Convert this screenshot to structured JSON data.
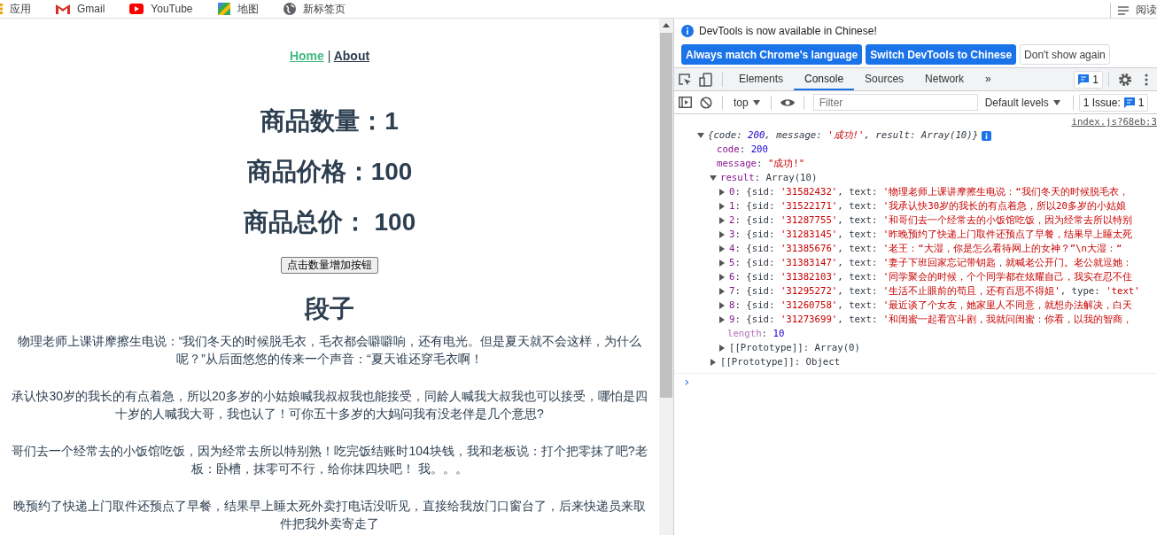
{
  "bookmarks": [
    {
      "label": "应用",
      "kind": "apps"
    },
    {
      "label": "Gmail",
      "kind": "gmail"
    },
    {
      "label": "YouTube",
      "kind": "youtube"
    },
    {
      "label": "地图",
      "kind": "maps"
    },
    {
      "label": "新标签页",
      "kind": "globe"
    }
  ],
  "reading_list": {
    "label": "阅读"
  },
  "page": {
    "nav": [
      {
        "label": "Home",
        "active": true
      },
      {
        "label": "About",
        "active": false
      }
    ],
    "nav_separator": "|",
    "stats": [
      "商品数量：1",
      "商品价格：100",
      "商品总价： 100"
    ],
    "button": "点击数量增加按钮",
    "heading": "段子",
    "jokes": [
      "物理老师上课讲摩擦生电说：“我们冬天的时候脱毛衣，毛衣都会噼噼响，还有电光。但是夏天就不会这样，为什么呢？”从后面悠悠的传来一个声音：“夏天谁还穿毛衣啊！",
      "承认快30岁的我长的有点着急，所以20多岁的小姑娘喊我叔叔我也能接受，同龄人喊我大叔我也可以接受，哪怕是四十岁的人喊我大哥，我也认了！可你五十多岁的大妈问我有没老伴是几个意思?",
      "哥们去一个经常去的小饭馆吃饭，因为经常去所以特别熟！吃完饭结账时104块钱，我和老板说：打个把零抹了吧?老板：卧槽，抹零可不行，给你抹四块吧！ 我。。。",
      "晚预约了快递上门取件还预点了早餐，结果早上睡太死外卖打电话没听见，直接给我放门口窗台了，后来快递员来取件把我外卖寄走了"
    ]
  },
  "devtools": {
    "notice": "DevTools is now available in Chinese!",
    "notice_buttons": [
      {
        "label": "Always match Chrome's language",
        "primary": true
      },
      {
        "label": "Switch DevTools to Chinese",
        "primary": true
      },
      {
        "label": "Don't show again",
        "primary": false
      }
    ],
    "tabs": [
      {
        "label": "Elements",
        "selected": false
      },
      {
        "label": "Console",
        "selected": true
      },
      {
        "label": "Sources",
        "selected": false
      },
      {
        "label": "Network",
        "selected": false
      }
    ],
    "more_tabs": "»",
    "messages_badge": "1",
    "context": "top",
    "filter_placeholder": "Filter",
    "levels": "Default levels",
    "issues": {
      "label": "1 Issue:",
      "count": "1"
    },
    "source_link": "index.js?68eb:3",
    "summary": {
      "expanded": true,
      "parts": [
        {
          "text": "{code: ",
          "kind": "plain"
        },
        {
          "text": "200",
          "kind": "number"
        },
        {
          "text": ", message: ",
          "kind": "plain"
        },
        {
          "text": "'成功!'",
          "kind": "string"
        },
        {
          "text": ", result: Array(10)}",
          "kind": "plain"
        }
      ]
    },
    "fields": [
      {
        "parts": [
          {
            "text": "code",
            "kind": "key"
          },
          {
            "text": ": ",
            "kind": "plain"
          },
          {
            "text": "200",
            "kind": "number"
          }
        ]
      },
      {
        "parts": [
          {
            "text": "message",
            "kind": "key"
          },
          {
            "text": ": ",
            "kind": "plain"
          },
          {
            "text": "\"成功!\"",
            "kind": "string"
          }
        ]
      }
    ],
    "result": {
      "expanded": true,
      "parts": [
        {
          "text": "result",
          "kind": "key"
        },
        {
          "text": ": Array(10)",
          "kind": "plain"
        }
      ]
    },
    "rows": [
      {
        "expanded": false,
        "parts": [
          {
            "text": "0",
            "kind": "key"
          },
          {
            "text": ": {sid: ",
            "kind": "plain"
          },
          {
            "text": "'31582432'",
            "kind": "string"
          },
          {
            "text": ", text: ",
            "kind": "plain"
          },
          {
            "text": "'物理老师上课讲摩擦生电说：“我们冬天的时候脱毛衣，",
            "kind": "string"
          }
        ]
      },
      {
        "expanded": false,
        "parts": [
          {
            "text": "1",
            "kind": "key"
          },
          {
            "text": ": {sid: ",
            "kind": "plain"
          },
          {
            "text": "'31522171'",
            "kind": "string"
          },
          {
            "text": ", text: ",
            "kind": "plain"
          },
          {
            "text": "'我承认快30岁的我长的有点着急，所以20多岁的小姑娘",
            "kind": "string"
          }
        ]
      },
      {
        "expanded": false,
        "parts": [
          {
            "text": "2",
            "kind": "key"
          },
          {
            "text": ": {sid: ",
            "kind": "plain"
          },
          {
            "text": "'31287755'",
            "kind": "string"
          },
          {
            "text": ", text: ",
            "kind": "plain"
          },
          {
            "text": "'和哥们去一个经常去的小饭馆吃饭，因为经常去所以特别",
            "kind": "string"
          }
        ]
      },
      {
        "expanded": false,
        "parts": [
          {
            "text": "3",
            "kind": "key"
          },
          {
            "text": ": {sid: ",
            "kind": "plain"
          },
          {
            "text": "'31283145'",
            "kind": "string"
          },
          {
            "text": ", text: ",
            "kind": "plain"
          },
          {
            "text": "'昨晚预约了快递上门取件还预点了早餐，结果早上睡太死",
            "kind": "string"
          }
        ]
      },
      {
        "expanded": false,
        "parts": [
          {
            "text": "4",
            "kind": "key"
          },
          {
            "text": ": {sid: ",
            "kind": "plain"
          },
          {
            "text": "'31385676'",
            "kind": "string"
          },
          {
            "text": ", text: ",
            "kind": "plain"
          },
          {
            "text": "'老王：“大湿，你是怎么看待网上的女神？”\\n大湿：“",
            "kind": "string"
          }
        ]
      },
      {
        "expanded": false,
        "parts": [
          {
            "text": "5",
            "kind": "key"
          },
          {
            "text": ": {sid: ",
            "kind": "plain"
          },
          {
            "text": "'31383147'",
            "kind": "string"
          },
          {
            "text": ", text: ",
            "kind": "plain"
          },
          {
            "text": "'妻子下班回家忘记带钥匙，就喊老公开门。老公就逗她：",
            "kind": "string"
          }
        ]
      },
      {
        "expanded": false,
        "parts": [
          {
            "text": "6",
            "kind": "key"
          },
          {
            "text": ": {sid: ",
            "kind": "plain"
          },
          {
            "text": "'31382103'",
            "kind": "string"
          },
          {
            "text": ", text: ",
            "kind": "plain"
          },
          {
            "text": "'同学聚会的时候，个个同学都在炫耀自己，我实在忍不住",
            "kind": "string"
          }
        ]
      },
      {
        "expanded": false,
        "parts": [
          {
            "text": "7",
            "kind": "key"
          },
          {
            "text": ": {sid: ",
            "kind": "plain"
          },
          {
            "text": "'31295272'",
            "kind": "string"
          },
          {
            "text": ", text: ",
            "kind": "plain"
          },
          {
            "text": "'生活不止眼前的苟且，还有百思不得姐'",
            "kind": "string"
          },
          {
            "text": ", type: ",
            "kind": "plain"
          },
          {
            "text": "'text'",
            "kind": "string"
          }
        ]
      },
      {
        "expanded": false,
        "parts": [
          {
            "text": "8",
            "kind": "key"
          },
          {
            "text": ": {sid: ",
            "kind": "plain"
          },
          {
            "text": "'31260758'",
            "kind": "string"
          },
          {
            "text": ", text: ",
            "kind": "plain"
          },
          {
            "text": "'最近谈了个女友，她家里人不同意，就想办法解决，白天",
            "kind": "string"
          }
        ]
      },
      {
        "expanded": false,
        "parts": [
          {
            "text": "9",
            "kind": "key"
          },
          {
            "text": ": {sid: ",
            "kind": "plain"
          },
          {
            "text": "'31273699'",
            "kind": "string"
          },
          {
            "text": ", text: ",
            "kind": "plain"
          },
          {
            "text": "'和闺蜜一起看宫斗剧，我就问闺蜜：你看，以我的智商，",
            "kind": "string"
          }
        ]
      }
    ],
    "length": {
      "parts": [
        {
          "text": "length",
          "kind": "meta"
        },
        {
          "text": ": ",
          "kind": "plain"
        },
        {
          "text": "10",
          "kind": "number"
        }
      ]
    },
    "prototypes": [
      {
        "expanded": false,
        "parts": [
          {
            "text": "[[Prototype]]: Array(0)",
            "kind": "plain"
          }
        ]
      },
      {
        "expanded": false,
        "parts": [
          {
            "text": "[[Prototype]]: Object",
            "kind": "plain"
          }
        ]
      }
    ],
    "prompt": "›"
  }
}
